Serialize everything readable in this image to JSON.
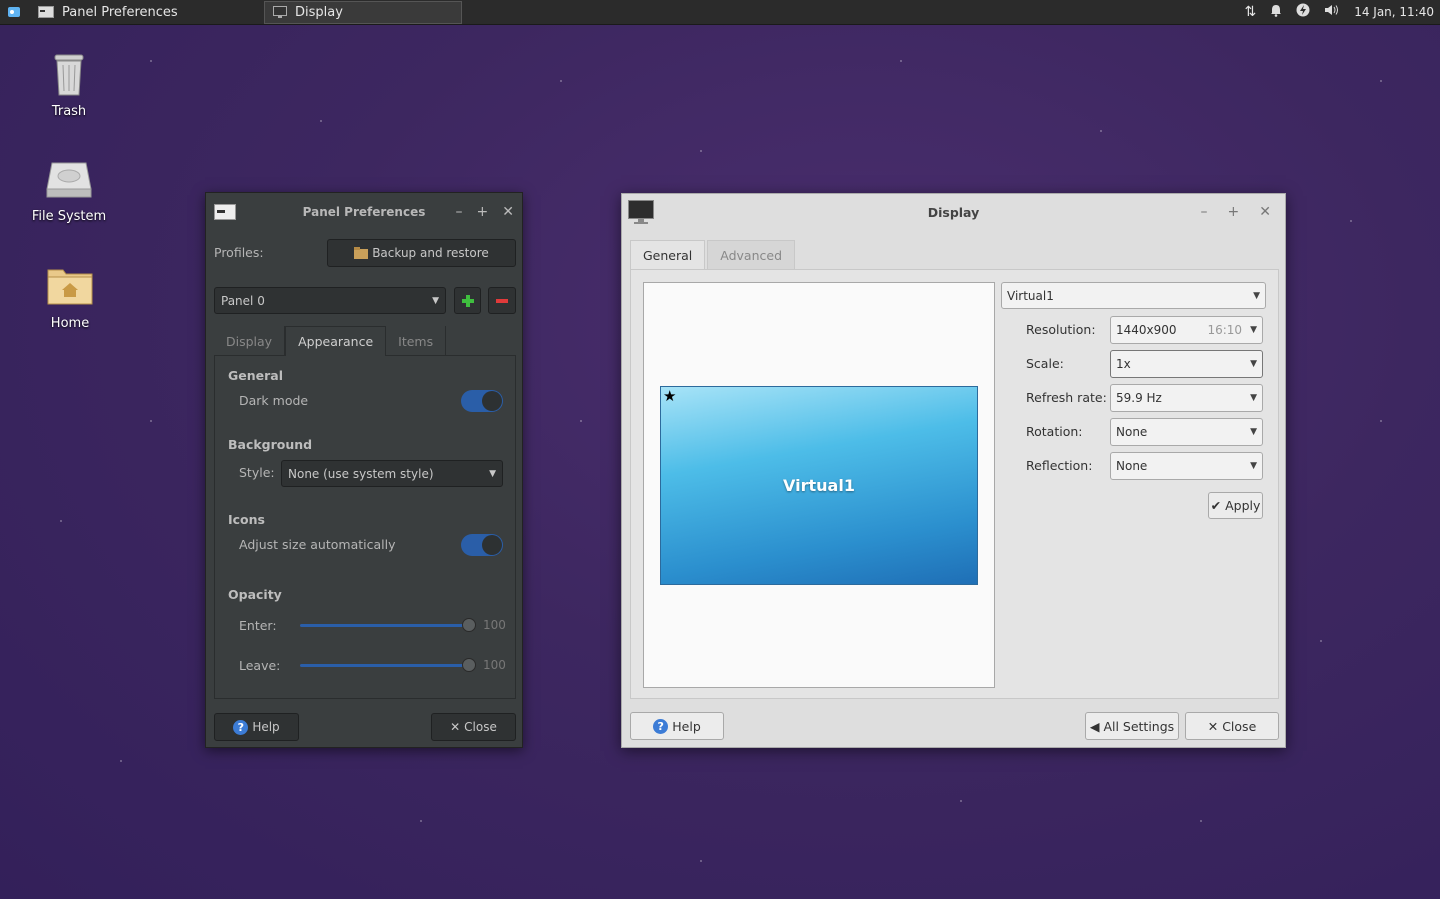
{
  "top_panel": {
    "tasks": [
      {
        "label": "Panel Preferences"
      },
      {
        "label": "Display"
      }
    ],
    "clock": "14 Jan, 11:40"
  },
  "desktop": {
    "icons": [
      {
        "label": "Trash"
      },
      {
        "label": "File System"
      },
      {
        "label": "Home"
      }
    ]
  },
  "panel_prefs": {
    "title": "Panel Preferences",
    "profiles_label": "Profiles:",
    "backup_button": "Backup and restore",
    "panel_select": "Panel 0",
    "tabs": [
      "Display",
      "Appearance",
      "Items"
    ],
    "general_heading": "General",
    "dark_mode_label": "Dark mode",
    "background_heading": "Background",
    "style_label": "Style:",
    "style_value": "None (use system style)",
    "icons_heading": "Icons",
    "adjust_size_label": "Adjust size automatically",
    "opacity_heading": "Opacity",
    "enter_label": "Enter:",
    "enter_value": "100",
    "leave_label": "Leave:",
    "leave_value": "100",
    "help_button": "Help",
    "close_button": "Close",
    "dark_mode_on": true,
    "adjust_size_on": true
  },
  "display": {
    "title": "Display",
    "tabs": [
      "General",
      "Advanced"
    ],
    "monitor_name": "Virtual1",
    "output_select": "Virtual1",
    "resolution_label": "Resolution:",
    "resolution_value": "1440x900",
    "resolution_aspect": "16:10",
    "scale_label": "Scale:",
    "scale_value": "1x",
    "refresh_label": "Refresh rate:",
    "refresh_value": "59.9 Hz",
    "rotation_label": "Rotation:",
    "rotation_value": "None",
    "reflection_label": "Reflection:",
    "reflection_value": "None",
    "apply_button": "Apply",
    "help_button": "Help",
    "all_settings_button": "All Settings",
    "close_button": "Close"
  },
  "colors": {
    "accent": "#2a5ea8",
    "desktop_bg": "#3d2760"
  }
}
